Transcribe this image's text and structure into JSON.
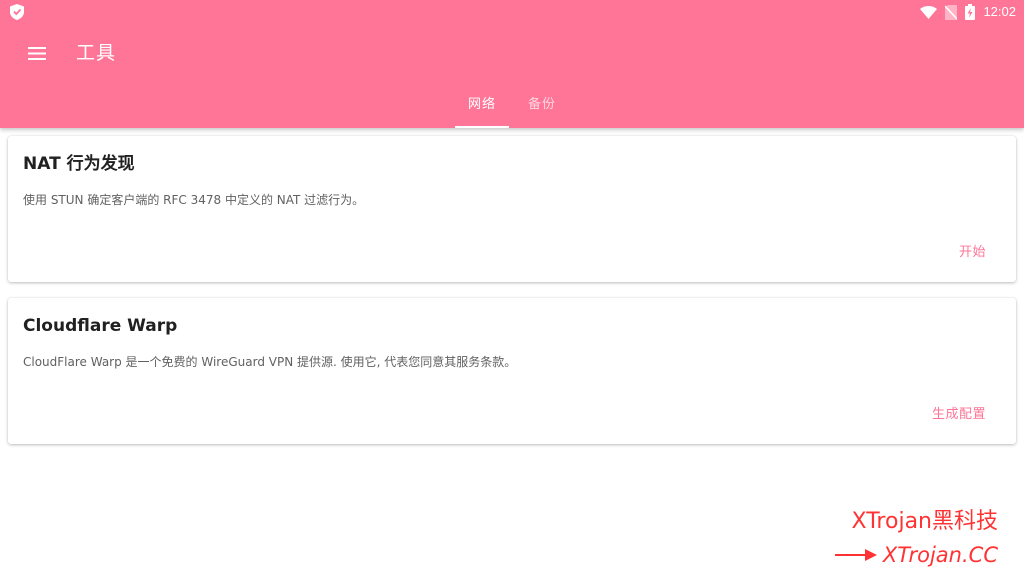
{
  "status_bar": {
    "time": "12:02",
    "icons": [
      "vpn-shield-icon",
      "wifi-icon",
      "no-sim-icon",
      "battery-charging-icon"
    ]
  },
  "app_bar": {
    "menu_icon": "hamburger-menu-icon",
    "title": "工具",
    "tabs": [
      {
        "label": "网络",
        "active": true
      },
      {
        "label": "备份",
        "active": false
      }
    ]
  },
  "cards": [
    {
      "title": "NAT 行为发现",
      "description": "使用 STUN 确定客户端的 RFC 3478 中定义的 NAT 过滤行为。",
      "action": "开始"
    },
    {
      "title": "Cloudflare Warp",
      "description": "CloudFlare Warp 是一个免费的 WireGuard VPN 提供源. 使用它, 代表您同意其服务条款。",
      "action": "生成配置"
    }
  ],
  "watermark": {
    "line1": "XTrojan黑科技",
    "line2": "XTrojan.CC"
  },
  "colors": {
    "accent": "#ff7597",
    "text_primary": "#212121",
    "text_secondary": "#616161",
    "watermark": "#ff3333"
  }
}
